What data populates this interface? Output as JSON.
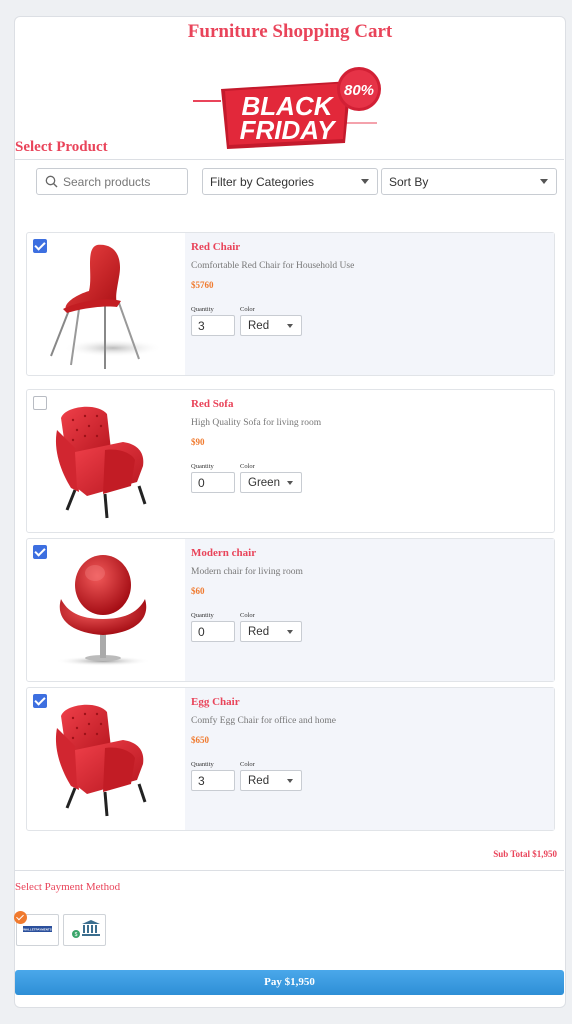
{
  "page": {
    "title": "Furniture Shopping Cart",
    "banner": {
      "line1": "BLACK",
      "line2": "FRIDAY",
      "discount": "80%"
    },
    "select_product_label": "Select Product"
  },
  "toolbar": {
    "search_placeholder": "Search products",
    "filter_label": "Filter by Categories",
    "sort_label": "Sort By"
  },
  "products": [
    {
      "name": "Red Chair",
      "description": "Comfortable Red Chair for Household Use",
      "price": "$5760",
      "quantity_label": "Quantity",
      "quantity": "3",
      "color_label": "Color",
      "color": "Red",
      "checked": true
    },
    {
      "name": "Red Sofa",
      "description": "High Quality Sofa for living room",
      "price": "$90",
      "quantity_label": "Quantity",
      "quantity": "0",
      "color_label": "Color",
      "color": "Green",
      "checked": false
    },
    {
      "name": "Modern chair",
      "description": "Modern chair for living room",
      "price": "$60",
      "quantity_label": "Quantity",
      "quantity": "0",
      "color_label": "Color",
      "color": "Red",
      "checked": true
    },
    {
      "name": "Egg Chair",
      "description": "Comfy Egg Chair for office and home",
      "price": "$650",
      "quantity_label": "Quantity",
      "quantity": "3",
      "color_label": "Color",
      "color": "Red",
      "checked": true
    }
  ],
  "subtotal": "Sub Total $1,950",
  "payment": {
    "label": "Select Payment Method",
    "methods": [
      {
        "icon": "wallet-card-icon",
        "selected": true,
        "brand_text": "WALLETPAYMENTS"
      },
      {
        "icon": "bank-transfer-icon",
        "selected": false
      }
    ]
  },
  "pay_button": "Pay $1,950",
  "colors": {
    "accent": "#e9445a",
    "price": "#f07a2e",
    "checkbox": "#3d6fe0",
    "button": "#3a9ae0"
  }
}
